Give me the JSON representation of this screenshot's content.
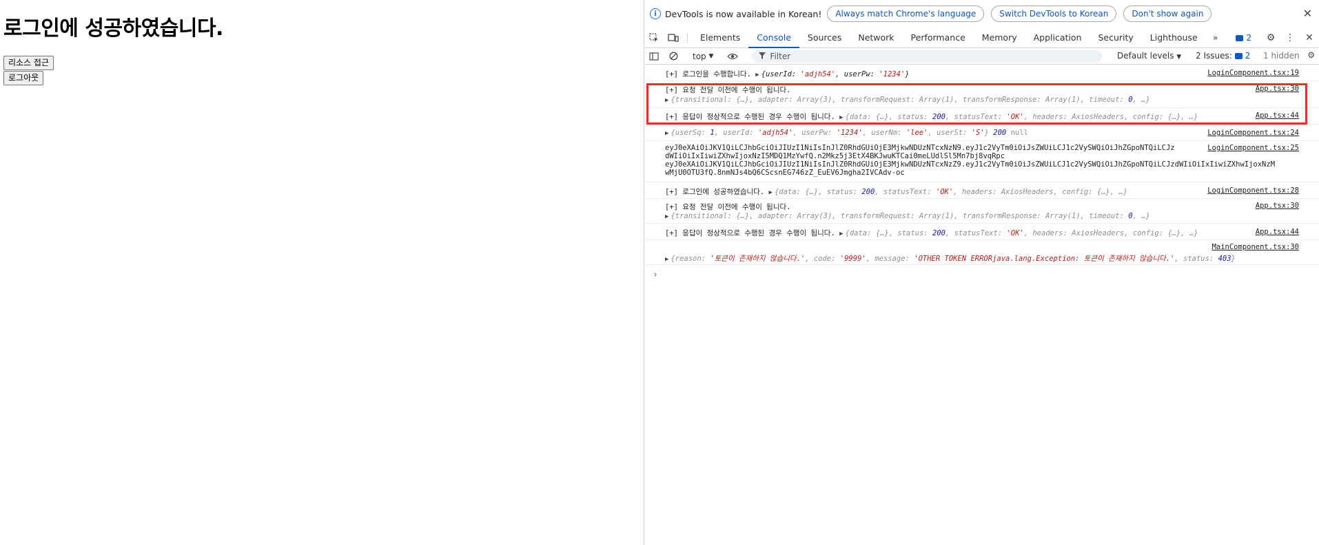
{
  "page": {
    "heading": "로그인에 성공하였습니다.",
    "resource_button": "리소스 접근",
    "logout_button": "로그아웃"
  },
  "infobar": {
    "message": "DevTools is now available in Korean!",
    "btn_match": "Always match Chrome's language",
    "btn_switch": "Switch DevTools to Korean",
    "btn_dont_show": "Don't show again"
  },
  "tabs": [
    "Elements",
    "Console",
    "Sources",
    "Network",
    "Performance",
    "Memory",
    "Application",
    "Security",
    "Lighthouse"
  ],
  "active_tab": "Console",
  "issues_badge": "2",
  "toolbar": {
    "context": "top",
    "filter_placeholder": "Filter",
    "levels": "Default levels",
    "issues_label": "2 Issues:",
    "issues_num": "2",
    "hidden": "1 hidden"
  },
  "console": {
    "r1": {
      "prefix": "[+] 로그인을 수행합니다.",
      "obj": "{userId: 'adjh54', userPw: '1234'}",
      "src": "LoginComponent.tsx:19"
    },
    "r2": {
      "prefix": "[+] 요청 전달 이전에 수행이 됩니다.",
      "obj": "{transitional: {…}, adapter: Array(3), transformRequest: Array(1), transformResponse: Array(1), timeout: 0, …}",
      "src": "App.tsx:30"
    },
    "r3": {
      "prefix": "[+] 응답이 정상적으로 수행된 경우 수행이 됩니다.",
      "obj": "{data: {…}, status: 200, statusText: 'OK', headers: AxiosHeaders, config: {…}, …}",
      "src": "App.tsx:44"
    },
    "r4": {
      "obj": "{userSq: 1, userId: 'adjh54', userPw: '1234', userNm: 'lee', userSt: 'S'}",
      "code": "200",
      "nul": "null",
      "src": "LoginComponent.tsx:24"
    },
    "r5": {
      "l1": "eyJ0eXAiOiJKV1QiLCJhbGciOiJIUzI1NiIsInJlZ0RhdGUiOjE3MjkwNDUzNTcxNzN9.eyJ1c2VyTm0iOiJsZWUiLCJ1c2VySWQiOiJhZGpoNTQiLCJz",
      "l2": "dWIiOiIxIiwiZXhwIjoxNzI5MDQ1MzYwfQ.n2Mkz5j3EtX4BKJwuKTCai0meLUdlSl5Mn7bj8vqRpc",
      "l3": "eyJ0eXAiOiJKV1QiLCJhbGciOiJIUzI1NiIsInJlZ0RhdGUiOjE3MjkwNDUzNTcxNzZ9.eyJ1c2VyTm0iOiJsZWUiLCJ1c2VySWQiOiJhZGpoNTQiLCJzdWIiOiIxIiwiZXhwIjoxNzM",
      "l4": "wMjU0OTU3fQ.8nmNJs4bQ6CScsnEG746zZ_EuEV6Jmgha2IVCAdv-oc",
      "src": "LoginComponent.tsx:25"
    },
    "r6": {
      "prefix": "[+] 로그인에 성공하였습니다.",
      "obj": "{data: {…}, status: 200, statusText: 'OK', headers: AxiosHeaders, config: {…}, …}",
      "src": "LoginComponent.tsx:28"
    },
    "r7": {
      "prefix": "[+] 요청 전달 이전에 수행이 됩니다.",
      "obj": "{transitional: {…}, adapter: Array(3), transformRequest: Array(1), transformResponse: Array(1), timeout: 0, …}",
      "src": "App.tsx:30"
    },
    "r8": {
      "prefix": "[+] 응답이 정상적으로 수행된 경우 수행이 됩니다.",
      "obj": "{data: {…}, status: 200, statusText: 'OK', headers: AxiosHeaders, config: {…}, …}",
      "src": "App.tsx:44"
    },
    "r9": {
      "obj": "{reason: '토큰이 존재하지 않습니다.', code: '9999', message: 'OTHER TOKEN ERRORjava.lang.Exception: 토큰이 존재하지 않습니다.', status: 403}",
      "src": "MainComponent.tsx:30"
    },
    "prompt": "›"
  },
  "colors": {
    "highlight": "#e8321f",
    "accent": "#0b57d0",
    "string": "#c41a16",
    "number": "#1a1aa6"
  }
}
